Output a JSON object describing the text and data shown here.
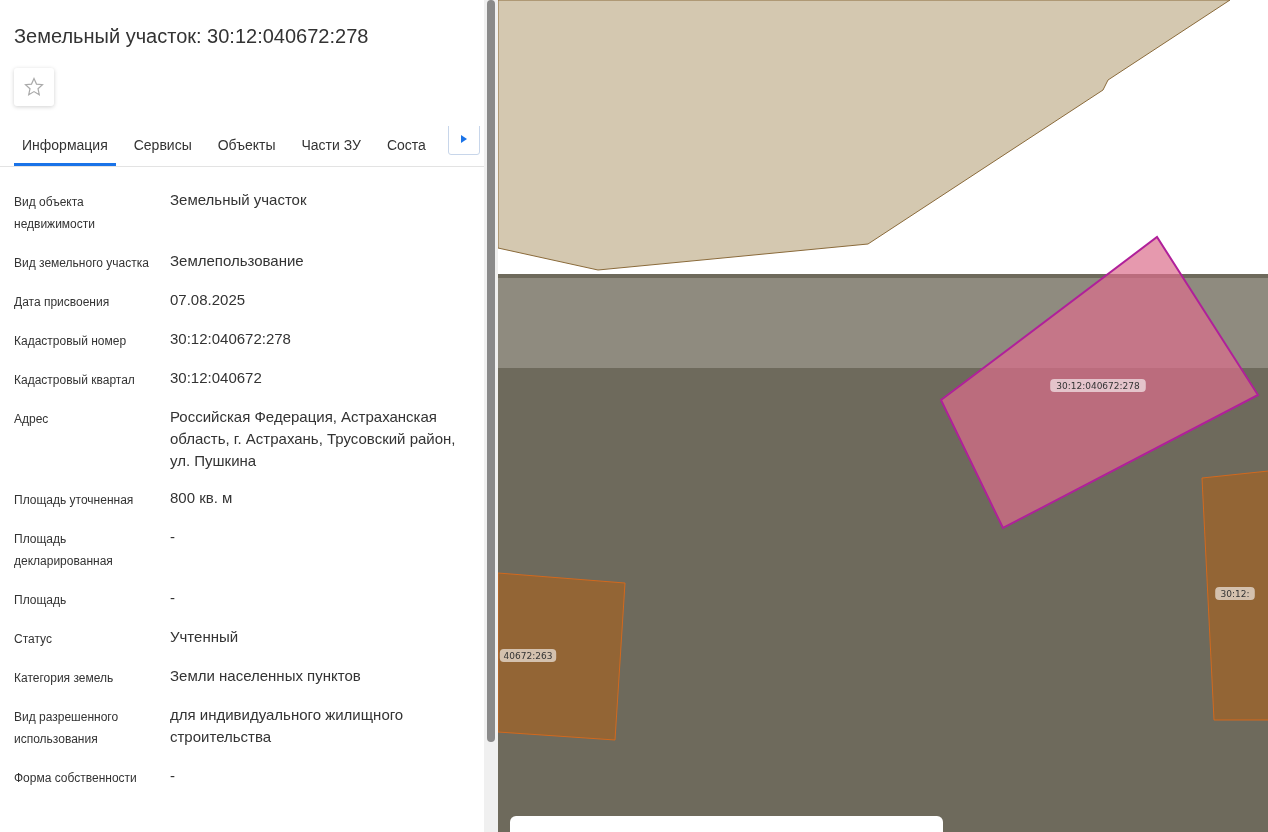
{
  "title": "Земельный участок: 30:12:040672:278",
  "favorite": {
    "selected": false
  },
  "tabs": [
    {
      "label": "Информация",
      "selected": true
    },
    {
      "label": "Сервисы",
      "selected": false
    },
    {
      "label": "Объекты",
      "selected": false
    },
    {
      "label": "Части ЗУ",
      "selected": false
    },
    {
      "label": "Соста",
      "selected": false
    }
  ],
  "fields": [
    {
      "label": "Вид объекта недвижимости",
      "value": "Земельный участок"
    },
    {
      "label": "Вид земельного участка",
      "value": "Землепользование"
    },
    {
      "label": "Дата присвоения",
      "value": "07.08.2025"
    },
    {
      "label": "Кадастровый номер",
      "value": "30:12:040672:278"
    },
    {
      "label": "Кадастровый квартал",
      "value": "30:12:040672"
    },
    {
      "label": "Адрес",
      "value": "Российская Федерация, Астраханская область, г. Астрахань, Трусовский район, ул. Пушкина"
    },
    {
      "label": "Площадь уточненная",
      "value": "800 кв. м"
    },
    {
      "label": "Площадь декларированная",
      "value": "-"
    },
    {
      "label": "Площадь",
      "value": "-"
    },
    {
      "label": "Статус",
      "value": "Учтенный"
    },
    {
      "label": "Категория земель",
      "value": "Земли населенных пунктов"
    },
    {
      "label": "Вид разрешенного использования",
      "value": "для индивидуального жилищного строительства"
    },
    {
      "label": "Форма собственности",
      "value": "-"
    }
  ],
  "map": {
    "parcels": [
      {
        "label": "30:12:040672:278",
        "selected": true
      },
      {
        "label": "40672:263",
        "selected": false
      },
      {
        "label": "30:12:",
        "selected": false
      }
    ]
  }
}
